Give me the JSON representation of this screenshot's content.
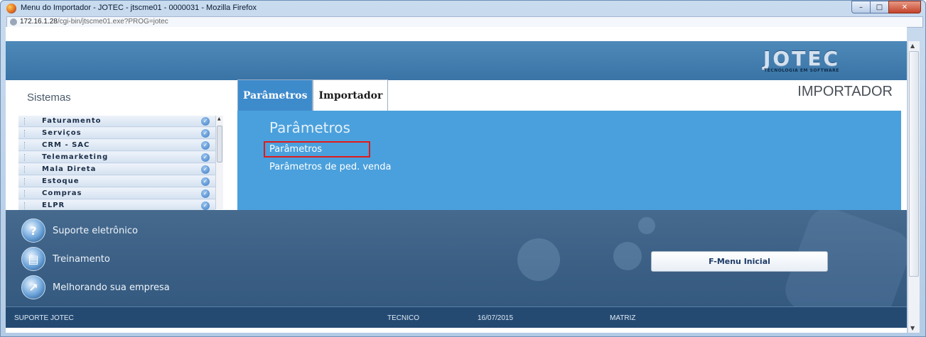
{
  "window": {
    "title": "Menu do Importador - JOTEC - jtscme01 - 0000031 - Mozilla Firefox",
    "url_host": "172.16.1.28",
    "url_path": "/cgi-bin/jtscme01.exe?PROG=jotec",
    "buttons": {
      "minimize": "–",
      "maximize": "□",
      "close": "✕"
    }
  },
  "header": {
    "logo": "JOTEC",
    "logo_tagline": "TECNOLOGIA EM SOFTWARE"
  },
  "sidebar": {
    "title": "Sistemas",
    "items": [
      {
        "label": "Faturamento"
      },
      {
        "label": "Serviços"
      },
      {
        "label": "CRM - SAC"
      },
      {
        "label": "Telemarketing"
      },
      {
        "label": "Mala Direta"
      },
      {
        "label": "Estoque"
      },
      {
        "label": "Compras"
      },
      {
        "label": "ELPR"
      }
    ],
    "item_icon": "check-circle-icon"
  },
  "tabs": [
    {
      "label": "Parâmetros",
      "active": true
    },
    {
      "label": "Importador",
      "active": false
    }
  ],
  "module_title": "IMPORTADOR",
  "main": {
    "heading": "Parâmetros",
    "links": [
      {
        "label": "Parâmetros",
        "highlighted": true
      },
      {
        "label": "Parâmetros de ped. venda",
        "highlighted": false
      }
    ]
  },
  "support": {
    "items": [
      {
        "label": "Suporte eletrônico",
        "icon": "help-icon"
      },
      {
        "label": "Treinamento",
        "icon": "training-icon"
      },
      {
        "label": "Melhorando sua empresa",
        "icon": "growth-chart-icon"
      }
    ],
    "menu_button": "F-Menu Inicial"
  },
  "status_bar": {
    "left": "SUPORTE JOTEC",
    "user": "TECNICO",
    "date": "16/07/2015",
    "branch": "MATRIZ"
  },
  "colors": {
    "main_panel": "#4aa0dc",
    "active_tab": "#3e8bcc",
    "highlight_border": "#e01b1b",
    "status_bar": "#244a72"
  }
}
